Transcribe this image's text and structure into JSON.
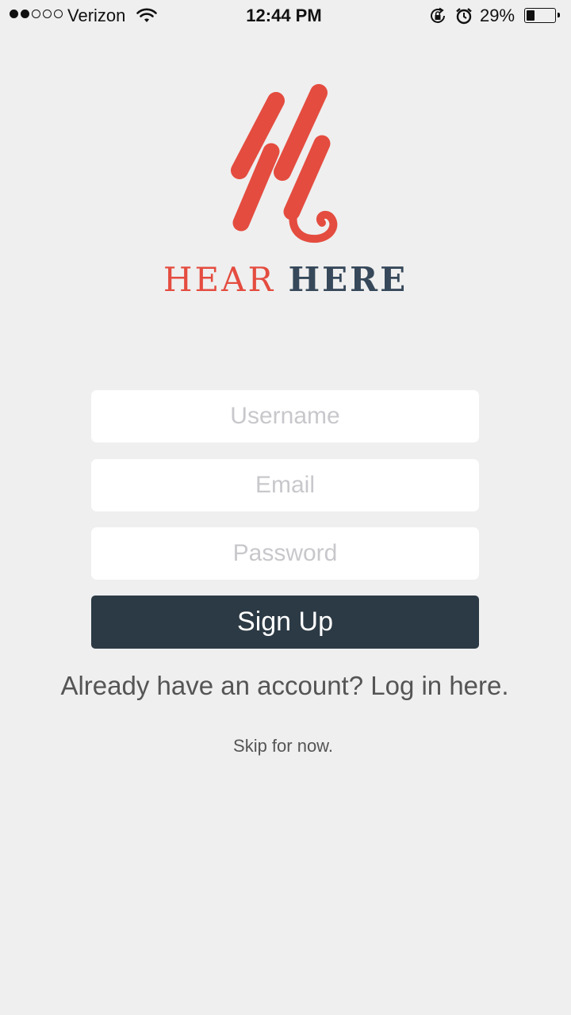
{
  "status_bar": {
    "carrier": "Verizon",
    "time": "12:44 PM",
    "battery_percent": "29%",
    "battery_level": 0.29,
    "signal_bars_filled": 2,
    "signal_bars_total": 5,
    "icons": [
      "wifi-icon",
      "rotation-lock-icon",
      "alarm-icon",
      "battery-icon"
    ]
  },
  "brand": {
    "name_part1": "HEAR",
    "name_part2": "HERE",
    "primary_color": "#e44c3f",
    "secondary_color": "#36485a"
  },
  "form": {
    "username_placeholder": "Username",
    "email_placeholder": "Email",
    "password_placeholder": "Password",
    "signup_label": "Sign Up",
    "button_color": "#2c3a45"
  },
  "links": {
    "login": "Already have an account? Log in here.",
    "skip": "Skip for now."
  }
}
